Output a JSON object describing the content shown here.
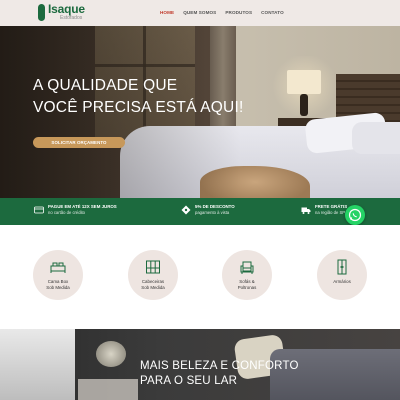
{
  "header": {
    "logo_name": "Isaque",
    "logo_sub": "Estofados",
    "nav": [
      "HOME",
      "QUEM SOMOS",
      "PRODUTOS",
      "CONTATO"
    ]
  },
  "hero": {
    "title_line1": "A QUALIDADE QUE",
    "title_line2": "VOCÊ PRECISA ESTÁ AQUI!",
    "cta": "SOLICITAR ORÇAMENTO"
  },
  "benefits": [
    {
      "title": "PAGUE EM ATÉ 12X SEM JUROS",
      "sub": "no cartão de crédito",
      "icon": "credit-card-icon"
    },
    {
      "title": "5% DE DESCONTO",
      "sub": "pagamento à vista",
      "icon": "discount-icon"
    },
    {
      "title": "FRETE GRÁTIS",
      "sub": "na região de SP",
      "icon": "truck-icon"
    }
  ],
  "categories": [
    {
      "line1": "Cama Box",
      "line2": "Sob Medida",
      "icon": "bed-icon"
    },
    {
      "line1": "Cabeceiras",
      "line2": "Sob Medida",
      "icon": "headboard-icon"
    },
    {
      "line1": "Sofás &",
      "line2": "Poltronas",
      "icon": "armchair-icon"
    },
    {
      "line1": "Armários",
      "line2": "",
      "icon": "wardrobe-icon"
    }
  ],
  "lower": {
    "title_line1": "MAIS BELEZA E CONFORTO",
    "title_line2": "PARA O SEU LAR"
  },
  "colors": {
    "brand_green": "#1c6a3e",
    "accent_gold": "#c7985a",
    "nav_active": "#c0392b",
    "category_bg": "#eee5e1",
    "whatsapp": "#25d366"
  }
}
